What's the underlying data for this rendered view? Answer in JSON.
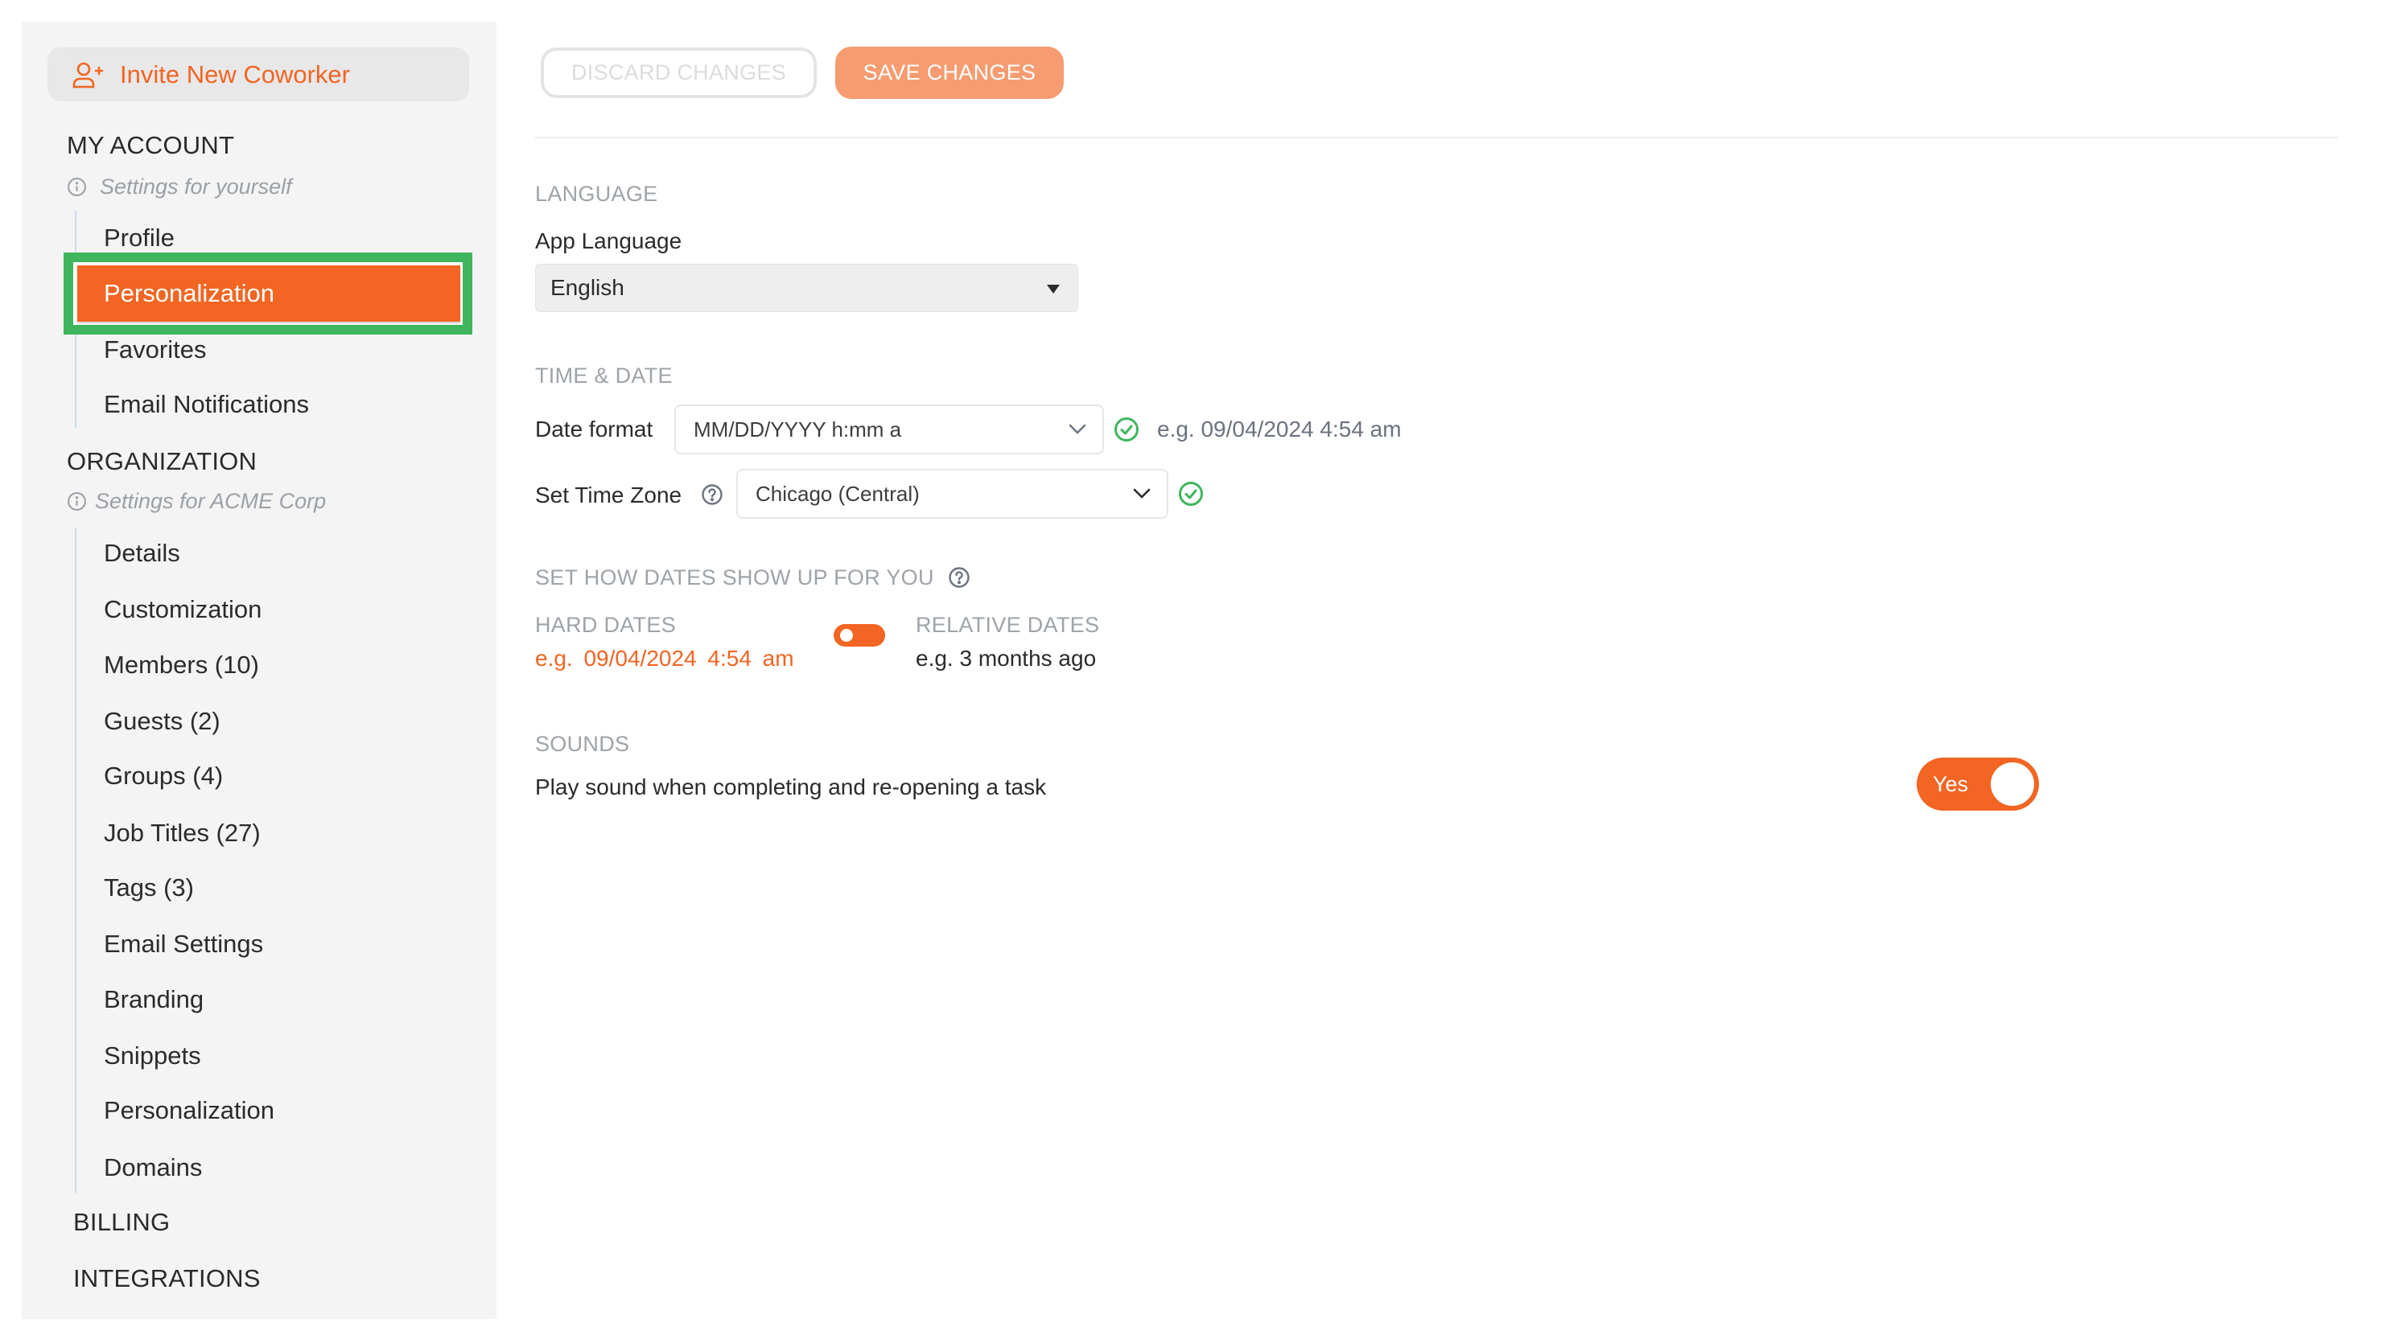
{
  "colors": {
    "accent": "#f26522",
    "accent_light": "#f69c70",
    "highlight_outline": "#3fb55e",
    "success": "#3fb55e",
    "sidebar_bg": "#f4f4f4"
  },
  "sidebar": {
    "invite_button": {
      "label": "Invite New Coworker",
      "icon": "user-plus-icon"
    },
    "my_account": {
      "title": "MY ACCOUNT",
      "subtitle": "Settings for yourself",
      "items": [
        {
          "label": "Profile",
          "active": false
        },
        {
          "label": "Personalization",
          "active": true
        },
        {
          "label": "Favorites",
          "active": false
        },
        {
          "label": "Email Notifications",
          "active": false
        }
      ]
    },
    "organization": {
      "title": "ORGANIZATION",
      "subtitle": "Settings for ACME Corp",
      "items": [
        {
          "label": "Details"
        },
        {
          "label": "Customization"
        },
        {
          "label": "Members (10)"
        },
        {
          "label": "Guests (2)"
        },
        {
          "label": "Groups (4)"
        },
        {
          "label": "Job Titles (27)"
        },
        {
          "label": "Tags (3)"
        },
        {
          "label": "Email Settings"
        },
        {
          "label": "Branding"
        },
        {
          "label": "Snippets"
        },
        {
          "label": "Personalization"
        },
        {
          "label": "Domains"
        }
      ]
    },
    "billing": {
      "title": "BILLING"
    },
    "integrations": {
      "title": "INTEGRATIONS"
    }
  },
  "toolbar": {
    "discard_label": "DISCARD CHANGES",
    "save_label": "SAVE CHANGES"
  },
  "main": {
    "language": {
      "heading": "LANGUAGE",
      "app_language_label": "App Language",
      "app_language_value": "English"
    },
    "time_date": {
      "heading": "TIME & DATE",
      "date_format_label": "Date format",
      "date_format_value": "MM/DD/YYYY h:mm a",
      "date_format_example": "e.g. 09/04/2024 4:54 am",
      "time_zone_label": "Set Time Zone",
      "time_zone_value": "Chicago (Central)"
    },
    "date_display": {
      "heading": "SET HOW DATES SHOW UP FOR YOU",
      "hard_dates_label": "HARD DATES",
      "hard_dates_example": "e.g. 09/04/2024 4:54 am",
      "relative_dates_label": "RELATIVE DATES",
      "relative_dates_example": "e.g. 3 months ago",
      "selected": "HARD DATES"
    },
    "sounds": {
      "heading": "SOUNDS",
      "label": "Play sound when completing and re-opening a task",
      "toggle_label": "Yes",
      "enabled": true
    }
  }
}
